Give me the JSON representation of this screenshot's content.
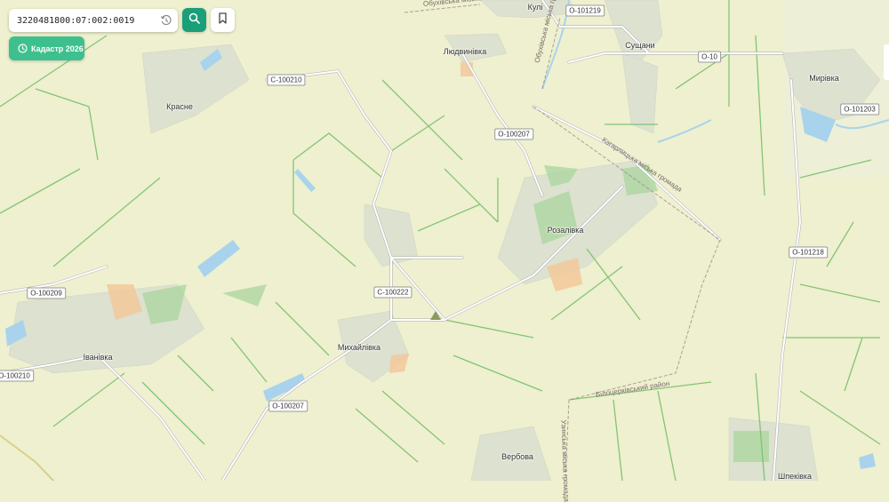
{
  "search": {
    "value": "3220481800:07:002:0019"
  },
  "cadastre_button": {
    "label": "Кадастр 2026"
  },
  "map": {
    "places": [
      {
        "name": "Кулі"
      },
      {
        "name": "Людвинівка"
      },
      {
        "name": "Сущани"
      },
      {
        "name": "Мирівка"
      },
      {
        "name": "Красне"
      },
      {
        "name": "Розалівка"
      },
      {
        "name": "Іванівка"
      },
      {
        "name": "Михайлівка"
      },
      {
        "name": "Вербова"
      },
      {
        "name": "Шпеківка"
      }
    ],
    "road_labels": [
      {
        "text": "С-100210"
      },
      {
        "text": "О-101219"
      },
      {
        "text": "О-10"
      },
      {
        "text": "О-101203"
      },
      {
        "text": "О-100207"
      },
      {
        "text": "О-101218"
      },
      {
        "text": "С-100222"
      },
      {
        "text": "О-100209"
      },
      {
        "text": "О-100210"
      },
      {
        "text": "О-100207"
      }
    ],
    "boundary_labels": [
      {
        "text": "Обухівська міська..."
      },
      {
        "text": "Обухівська міська громада"
      },
      {
        "text": "Кагарлицька міська громада"
      },
      {
        "text": "Білоцерківський район"
      },
      {
        "text": "Узинська міська громада"
      }
    ]
  },
  "colors": {
    "accent": "#1a9f78",
    "cadastre": "#3ec08e",
    "land": "#eef0cf",
    "field": "#7fc874",
    "water": "#a9d3ec",
    "settlement": "#dfe3d3"
  }
}
